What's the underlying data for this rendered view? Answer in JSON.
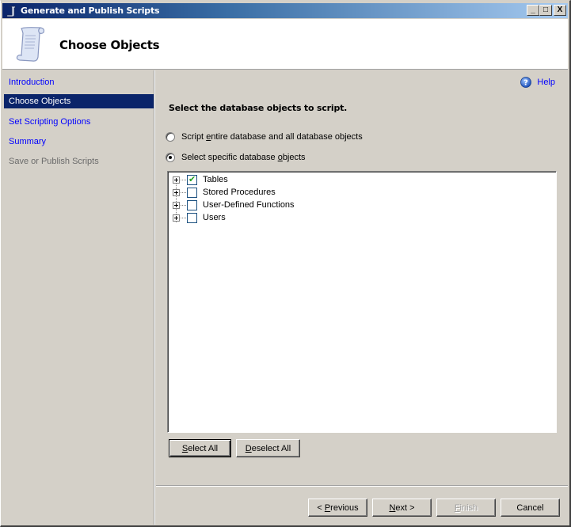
{
  "window": {
    "title": "Generate and Publish Scripts",
    "controls": {
      "minimize": "_",
      "maximize": "□",
      "close": "X"
    }
  },
  "header": {
    "heading": "Choose Objects",
    "icon": "scroll-icon"
  },
  "sidebar": {
    "items": [
      {
        "label": "Introduction",
        "state": "link"
      },
      {
        "label": "Choose Objects",
        "state": "active"
      },
      {
        "label": "Set Scripting Options",
        "state": "link"
      },
      {
        "label": "Summary",
        "state": "link"
      },
      {
        "label": "Save or Publish Scripts",
        "state": "disabled"
      }
    ]
  },
  "main": {
    "help_label": "Help",
    "prompt": "Select the database objects to script.",
    "options": [
      {
        "pre": "Script ",
        "accel": "e",
        "post": "ntire database and all database objects",
        "selected": false
      },
      {
        "pre": "Select specific database ",
        "accel": "o",
        "post": "bjects",
        "selected": true
      }
    ],
    "tree": [
      {
        "label": "Tables",
        "checked": true
      },
      {
        "label": "Stored Procedures",
        "checked": false
      },
      {
        "label": "User-Defined Functions",
        "checked": false
      },
      {
        "label": "Users",
        "checked": false
      }
    ],
    "select_all": {
      "accel": "S",
      "rest": "elect All"
    },
    "deselect_all": {
      "accel": "D",
      "rest": "eselect All"
    }
  },
  "footer": {
    "previous": {
      "pre": "< ",
      "accel": "P",
      "post": "revious"
    },
    "next": {
      "pre": "",
      "accel": "N",
      "post": "ext >"
    },
    "finish": {
      "pre": "",
      "accel": "F",
      "post": "inish",
      "disabled": true
    },
    "cancel": "Cancel"
  },
  "colors": {
    "active_nav_bg": "#0a246a",
    "link": "#0000ff",
    "face": "#d4d0c8",
    "check": "#21a121"
  }
}
